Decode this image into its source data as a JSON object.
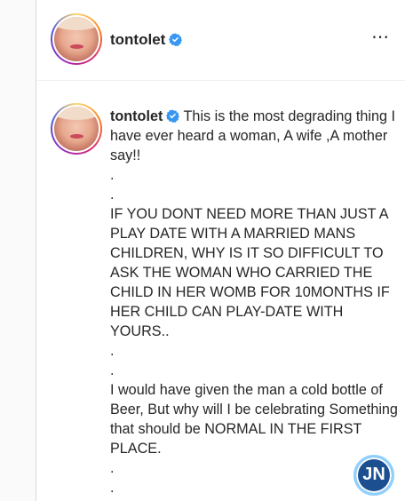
{
  "post": {
    "username": "tontolet",
    "more_icon": "⋯",
    "caption": {
      "text": " This is the most degrading thing I have ever heard a woman, A wife ,A mother say!!\n.\n.\nIF YOU DONT NEED MORE THAN JUST A PLAY DATE WITH A MARRIED MANS CHILDREN, WHY IS IT SO DIFFICULT TO ASK THE WOMAN WHO CARRIED THE CHILD IN HER WOMB FOR 10MONTHS IF HER CHILD CAN PLAY-DATE WITH YOURS..\n.\n.\nI would have given the man a cold bottle of Beer, But why will I be celebrating Something that should be NORMAL IN THE FIRST PLACE.\n.\n."
    }
  },
  "watermark": {
    "logo_text": "JN"
  },
  "colors": {
    "verified": "#3897f0",
    "text": "#262626",
    "background": "#fafafa"
  }
}
